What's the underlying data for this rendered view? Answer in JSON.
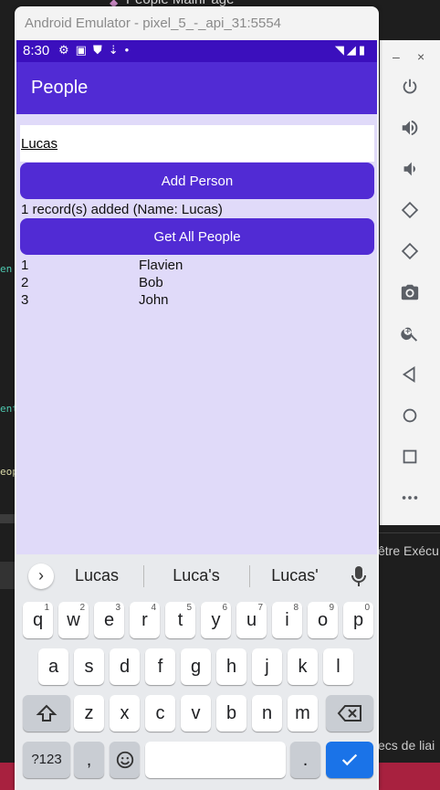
{
  "ide": {
    "tab_label": "People MainPage",
    "right_text_1": "être Exécu",
    "right_text_2": "ecs de liai",
    "left_fragments": [
      "en",
      "ent",
      "eop"
    ]
  },
  "emulator": {
    "title": "Android Emulator - pixel_5_-_api_31:5554",
    "window_controls": {
      "minimize": "–",
      "close": "×"
    }
  },
  "status_bar": {
    "time": "8:30",
    "icons": [
      "gear-icon",
      "a-icon",
      "shield-icon",
      "download-icon",
      "dot-icon"
    ],
    "right_icons": [
      "wifi-icon",
      "signal-icon",
      "battery-icon"
    ]
  },
  "app": {
    "title": "People",
    "name_input": {
      "value": "Lucas",
      "placeholder": ""
    },
    "add_button_label": "Add Person",
    "status_message": "1 record(s) added (Name: Lucas)",
    "get_all_button_label": "Get All People",
    "people": [
      {
        "id": "1",
        "name": "Flavien"
      },
      {
        "id": "2",
        "name": "Bob"
      },
      {
        "id": "3",
        "name": "John"
      }
    ]
  },
  "keyboard": {
    "suggestions": [
      "Lucas",
      "Luca's",
      "Lucas'"
    ],
    "row1": [
      {
        "key": "q",
        "hint": "1"
      },
      {
        "key": "w",
        "hint": "2"
      },
      {
        "key": "e",
        "hint": "3"
      },
      {
        "key": "r",
        "hint": "4"
      },
      {
        "key": "t",
        "hint": "5"
      },
      {
        "key": "y",
        "hint": "6"
      },
      {
        "key": "u",
        "hint": "7"
      },
      {
        "key": "i",
        "hint": "8"
      },
      {
        "key": "o",
        "hint": "9"
      },
      {
        "key": "p",
        "hint": "0"
      }
    ],
    "row2": [
      "a",
      "s",
      "d",
      "f",
      "g",
      "h",
      "j",
      "k",
      "l"
    ],
    "row3": [
      "z",
      "x",
      "c",
      "v",
      "b",
      "n",
      "m"
    ],
    "symbols_label": "?123",
    "comma_label": ",",
    "period_label": ".",
    "emoji_icon": "emoji-icon",
    "enter_icon": "check-icon",
    "shift_icon": "shift-icon",
    "backspace_icon": "backspace-icon"
  },
  "side_panel": {
    "buttons": [
      "power",
      "volume-up",
      "volume-down",
      "rotate-left",
      "rotate-right",
      "screenshot",
      "zoom",
      "back",
      "home",
      "overview",
      "more"
    ]
  },
  "colors": {
    "primary": "#512bd4",
    "status_bar": "#3b0fbd",
    "page_background": "#e0daf9",
    "keyboard_background": "#e8eaed",
    "enter_key": "#1a73e8"
  }
}
